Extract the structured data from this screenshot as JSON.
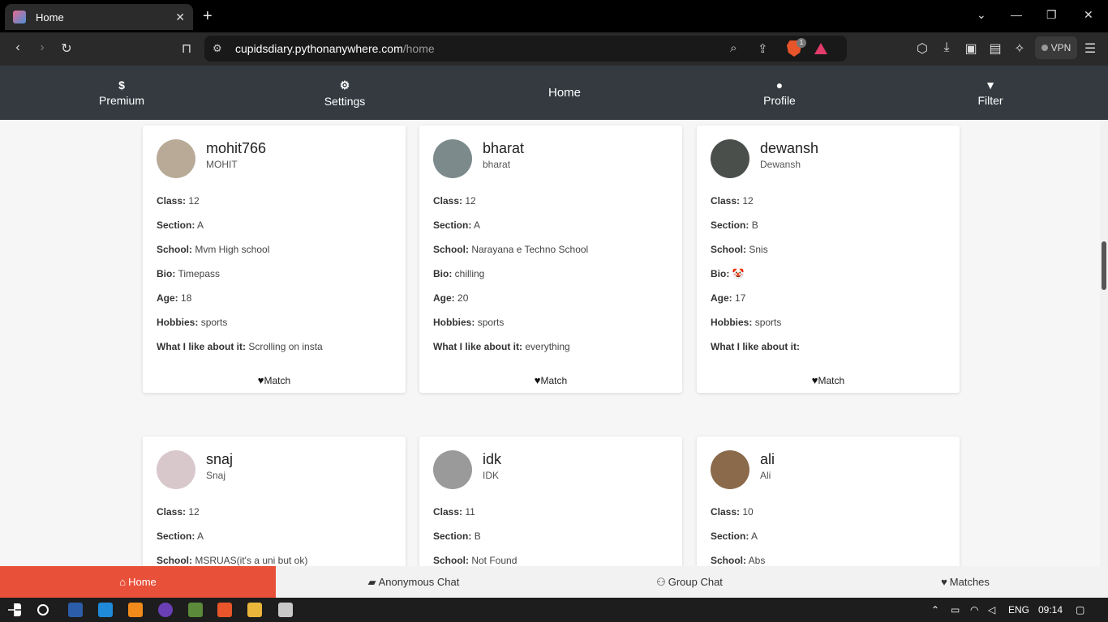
{
  "browser": {
    "tab_title": "Home",
    "url_domain": "cupidsdiary.pythonanywhere.com",
    "url_path": "/home",
    "shield_badge": "1",
    "vpn_label": "VPN"
  },
  "nav": {
    "premium": "Premium",
    "settings": "Settings",
    "home": "Home",
    "profile": "Profile",
    "filter": "Filter"
  },
  "labels": {
    "class": "Class:",
    "section": "Section:",
    "school": "School:",
    "bio": "Bio:",
    "age": "Age:",
    "hobbies": "Hobbies:",
    "like": "What I like about it:",
    "match": "Match"
  },
  "profiles": [
    {
      "username": "mohit766",
      "name": "MOHIT",
      "class": "12",
      "section": "A",
      "school": "Mvm High school",
      "bio": "Timepass",
      "age": "18",
      "hobbies": "sports",
      "like": "Scrolling on insta",
      "avatar_color": "#b9aa98"
    },
    {
      "username": "bharat",
      "name": "bharat",
      "class": "12",
      "section": "A",
      "school": "Narayana e Techno School",
      "bio": "chilling",
      "age": "20",
      "hobbies": "sports",
      "like": "everything",
      "avatar_color": "#7c8a8c"
    },
    {
      "username": "dewansh",
      "name": "Dewansh",
      "class": "12",
      "section": "B",
      "school": "Snis",
      "bio": "🤡",
      "age": "17",
      "hobbies": "sports",
      "like": "",
      "avatar_color": "#4a4f4c"
    },
    {
      "username": "snaj",
      "name": "Snaj",
      "class": "12",
      "section": "A",
      "school": "MSRUAS(it's a uni but ok)",
      "avatar_color": "#d8c8cc"
    },
    {
      "username": "idk",
      "name": "IDK",
      "class": "11",
      "section": "B",
      "school": "Not Found",
      "avatar_color": "#9a9a9a"
    },
    {
      "username": "ali",
      "name": "Ali",
      "class": "10",
      "section": "A",
      "school": "Abs",
      "avatar_color": "#8a6a4a"
    }
  ],
  "bottom_nav": {
    "home": "Home",
    "anon_chat": "Anonymous Chat",
    "group_chat": "Group Chat",
    "matches": "Matches"
  },
  "taskbar": {
    "lang": "ENG",
    "time": "09:14"
  }
}
